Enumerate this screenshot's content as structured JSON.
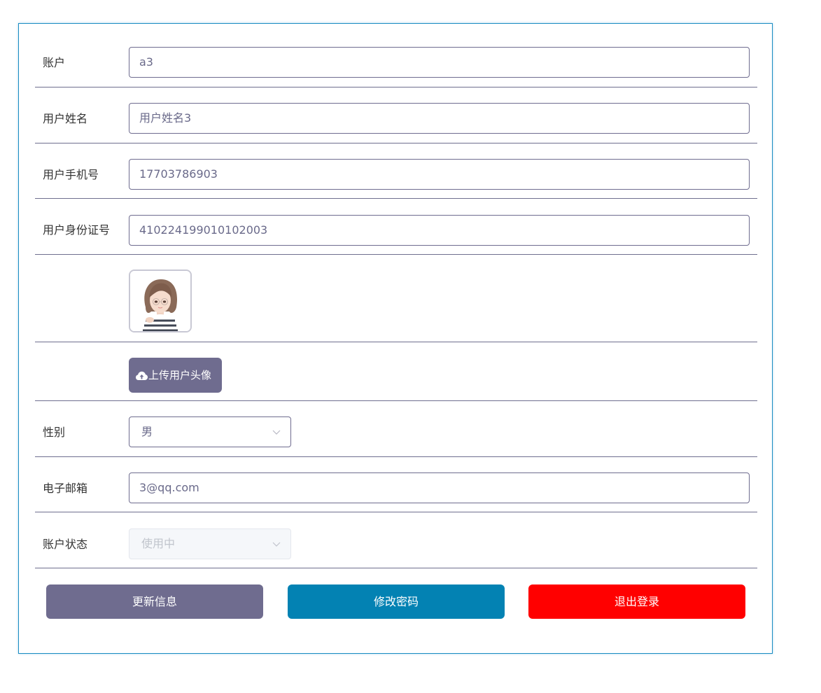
{
  "form": {
    "account": {
      "label": "账户",
      "value": "a3"
    },
    "user_name": {
      "label": "用户姓名",
      "value": "用户姓名3"
    },
    "phone": {
      "label": "用户手机号",
      "value": "17703786903"
    },
    "id_card": {
      "label": "用户身份证号",
      "value": "410224199010102003"
    },
    "avatar": {
      "icon": "avatar-image"
    },
    "upload": {
      "label": "上传用户头像",
      "icon": "cloud-upload-icon"
    },
    "gender": {
      "label": "性别",
      "value": "男"
    },
    "email": {
      "label": "电子邮箱",
      "value": "3@qq.com"
    },
    "status": {
      "label": "账户状态",
      "value": "使用中",
      "disabled": true
    }
  },
  "actions": {
    "update_label": "更新信息",
    "change_password_label": "修改密码",
    "logout_label": "退出登录"
  },
  "colors": {
    "primary": "#6f6c8f",
    "secondary": "#0382b3",
    "danger": "#ff0000",
    "card_border": "#1a8cc2"
  }
}
